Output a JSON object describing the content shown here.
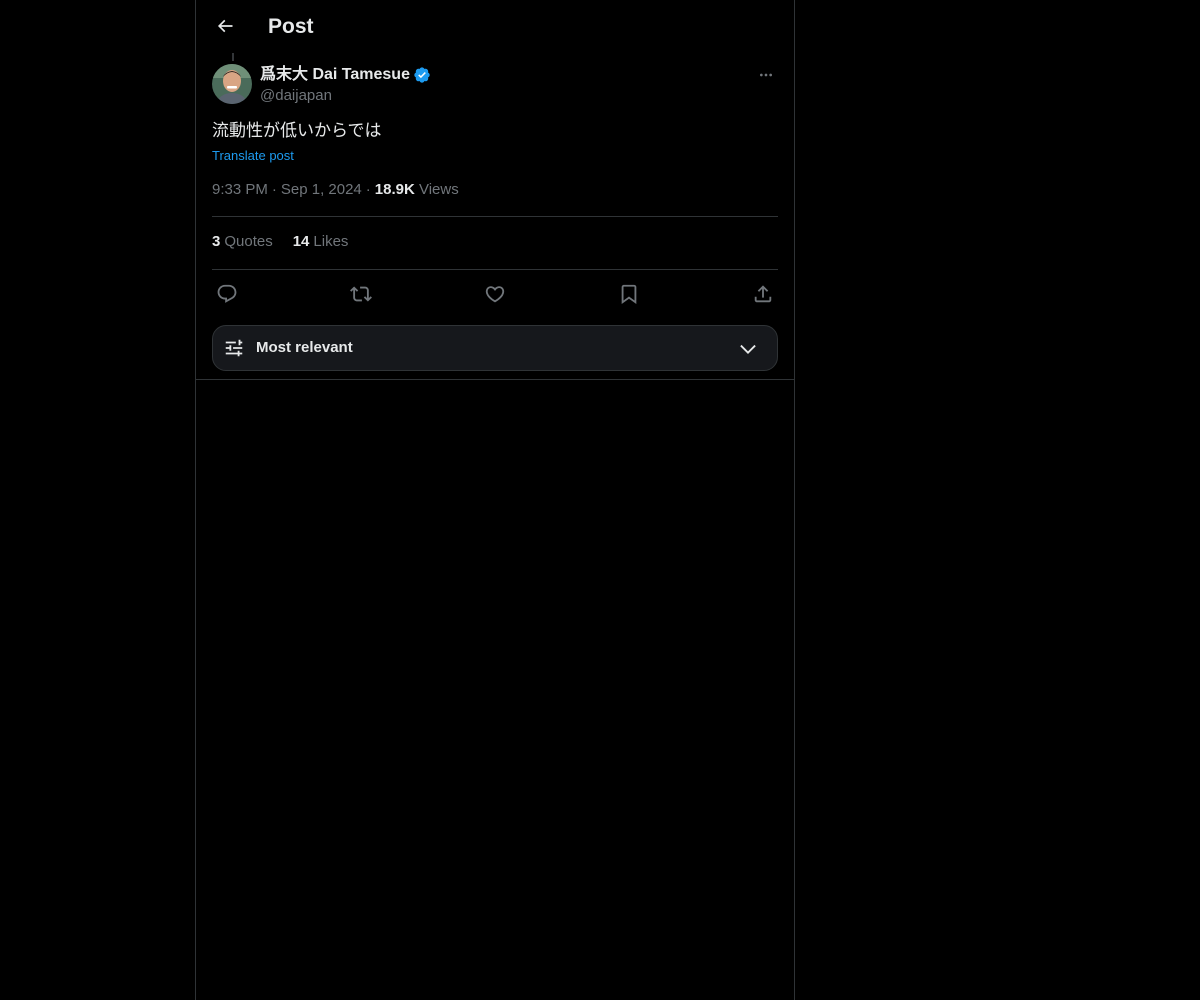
{
  "header": {
    "title": "Post",
    "back_icon": "arrow-left-icon"
  },
  "post": {
    "author": {
      "name": "爲末大 Dai Tamesue",
      "handle": "@daijapan",
      "verified": true,
      "avatar_icon": "user-avatar"
    },
    "text": "流動性が低いからでは",
    "translate_label": "Translate post",
    "time": "9:33 PM",
    "date": "Sep 1, 2024",
    "views_count": "18.9K",
    "views_label": "Views",
    "stats": [
      {
        "count": "3",
        "label": "Quotes"
      },
      {
        "count": "14",
        "label": "Likes"
      }
    ],
    "actions": [
      "reply-icon",
      "repost-icon",
      "like-icon",
      "bookmark-icon",
      "share-icon"
    ]
  },
  "sort": {
    "label": "Most relevant",
    "icon": "filter-sliders-icon",
    "chevron": "chevron-down-icon"
  },
  "colors": {
    "background": "#000000",
    "text": "#e7e9ea",
    "muted": "#71767b",
    "accent": "#1d9bf0",
    "border": "#2f3336"
  }
}
